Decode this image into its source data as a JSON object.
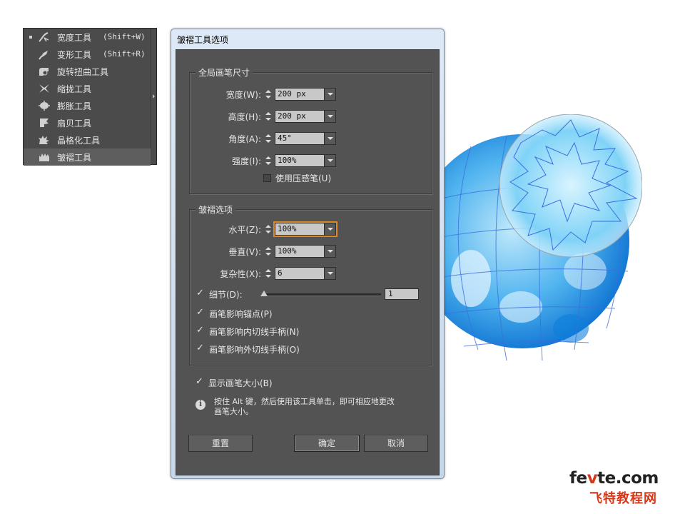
{
  "tool_panel": {
    "tools": [
      {
        "name": "宽度工具",
        "shortcut": "(Shift+W)",
        "icon": "width-tool-icon",
        "current": true
      },
      {
        "name": "变形工具",
        "shortcut": "(Shift+R)",
        "icon": "warp-tool-icon"
      },
      {
        "name": "旋转扭曲工具",
        "shortcut": "",
        "icon": "twirl-tool-icon"
      },
      {
        "name": "缩拢工具",
        "shortcut": "",
        "icon": "pucker-tool-icon"
      },
      {
        "name": "膨胀工具",
        "shortcut": "",
        "icon": "bloat-tool-icon"
      },
      {
        "name": "扇贝工具",
        "shortcut": "",
        "icon": "scallop-tool-icon"
      },
      {
        "name": "晶格化工具",
        "shortcut": "",
        "icon": "crystallize-tool-icon"
      },
      {
        "name": "皱褶工具",
        "shortcut": "",
        "icon": "wrinkle-tool-icon",
        "selected": true
      }
    ]
  },
  "dialog": {
    "title": "皱褶工具选项",
    "brush_group": {
      "title": "全局画笔尺寸",
      "width_label": "宽度(W):",
      "width_value": "200 px",
      "height_label": "高度(H):",
      "height_value": "200 px",
      "angle_label": "角度(A):",
      "angle_value": "45°",
      "intensity_label": "强度(I):",
      "intensity_value": "100%",
      "pressure_label": "使用压感笔(U)",
      "pressure_checked": false
    },
    "wrinkle_group": {
      "title": "皱褶选项",
      "horizontal_label": "水平(Z):",
      "horizontal_value": "100%",
      "vertical_label": "垂直(V):",
      "vertical_value": "100%",
      "complexity_label": "复杂性(X):",
      "complexity_value": "6",
      "detail_label": "细节(D):",
      "detail_value": "1",
      "detail_checked": true,
      "anchor_label": "画笔影响锚点(P)",
      "anchor_checked": true,
      "in_handles_label": "画笔影响内切线手柄(N)",
      "in_handles_checked": true,
      "out_handles_label": "画笔影响外切线手柄(O)",
      "out_handles_checked": true
    },
    "show_brush_size_label": "显示画笔大小(B)",
    "show_brush_size_checked": true,
    "info_line1": "按住 Alt 键，然后使用该工具单击，即可相应地更改",
    "info_line2": "画笔大小。",
    "reset_label": "重置",
    "ok_label": "确定",
    "cancel_label": "取消"
  },
  "watermark": {
    "part1": "fe",
    "accent": "v",
    "part2": "te.com",
    "cn": "飞特教程网"
  },
  "colors": {
    "panel_bg": "#535353",
    "globe_blue": "#1e8fe0",
    "watermark_red": "#d43a1a"
  }
}
